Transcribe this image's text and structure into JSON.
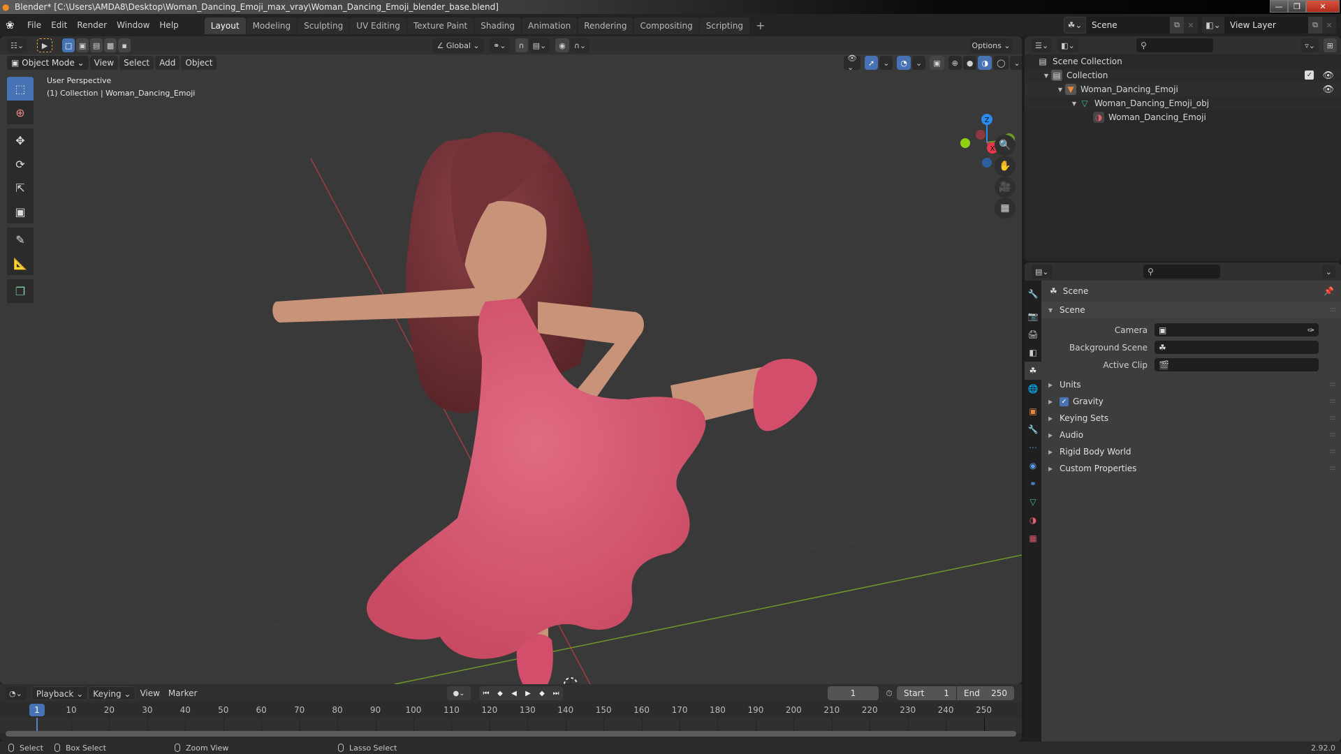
{
  "window": {
    "title": "Blender* [C:\\Users\\AMDA8\\Desktop\\Woman_Dancing_Emoji_max_vray\\Woman_Dancing_Emoji_blender_base.blend]",
    "minimize": "—",
    "maximize": "❐",
    "close": "✕"
  },
  "menu": [
    "File",
    "Edit",
    "Render",
    "Window",
    "Help"
  ],
  "workspaces": [
    "Layout",
    "Modeling",
    "Sculpting",
    "UV Editing",
    "Texture Paint",
    "Shading",
    "Animation",
    "Rendering",
    "Compositing",
    "Scripting"
  ],
  "workspace_active": "Layout",
  "workspace_add": "+",
  "scene_selector": {
    "value": "Scene"
  },
  "view_layer_selector": {
    "value": "View Layer"
  },
  "viewport": {
    "transform_orientation": "Global",
    "options_label": "Options",
    "mode": "Object Mode",
    "menus": [
      "View",
      "Select",
      "Add",
      "Object"
    ],
    "info_line1": "User Perspective",
    "info_line2": "(1) Collection | Woman_Dancing_Emoji",
    "gizmo_axes": {
      "x": "X",
      "y": "Y",
      "z": "Z"
    },
    "colors": {
      "dress": "#d95a72",
      "skin": "#c9937a",
      "hair": "#6e3035",
      "x_axis": "#b23b45",
      "y_axis": "#6c9a2a",
      "background": "#393939"
    },
    "shading_mode": "solid"
  },
  "outliner": {
    "rows": [
      {
        "label": "Scene Collection",
        "icon": "scene-collection-icon"
      },
      {
        "label": "Collection",
        "icon": "collection-icon"
      },
      {
        "label": "Woman_Dancing_Emoji",
        "icon": "object-icon"
      },
      {
        "label": "Woman_Dancing_Emoji_obj",
        "icon": "mesh-icon"
      },
      {
        "label": "Woman_Dancing_Emoji",
        "icon": "material-icon"
      }
    ]
  },
  "properties": {
    "context": "Scene",
    "panel_scene": "Scene",
    "fields": [
      {
        "label": "Camera",
        "value": ""
      },
      {
        "label": "Background Scene",
        "value": ""
      },
      {
        "label": "Active Clip",
        "value": ""
      }
    ],
    "panels": [
      "Units",
      "Gravity",
      "Keying Sets",
      "Audio",
      "Rigid Body World",
      "Custom Properties"
    ],
    "gravity_enabled": true
  },
  "timeline": {
    "menus": [
      "Playback",
      "Keying",
      "View",
      "Marker"
    ],
    "current_frame": "1",
    "start_label": "Start",
    "start": "1",
    "end_label": "End",
    "end": "250",
    "ticks": [
      "10",
      "20",
      "30",
      "40",
      "50",
      "60",
      "70",
      "80",
      "90",
      "100",
      "110",
      "120",
      "130",
      "140",
      "150",
      "160",
      "170",
      "180",
      "190",
      "200",
      "210",
      "220",
      "230",
      "240",
      "250"
    ],
    "playhead_label": "1"
  },
  "statusbar": {
    "select": "Select",
    "box_select": "Box Select",
    "zoom_view": "Zoom View",
    "lasso_select": "Lasso Select",
    "version": "2.92.0"
  }
}
